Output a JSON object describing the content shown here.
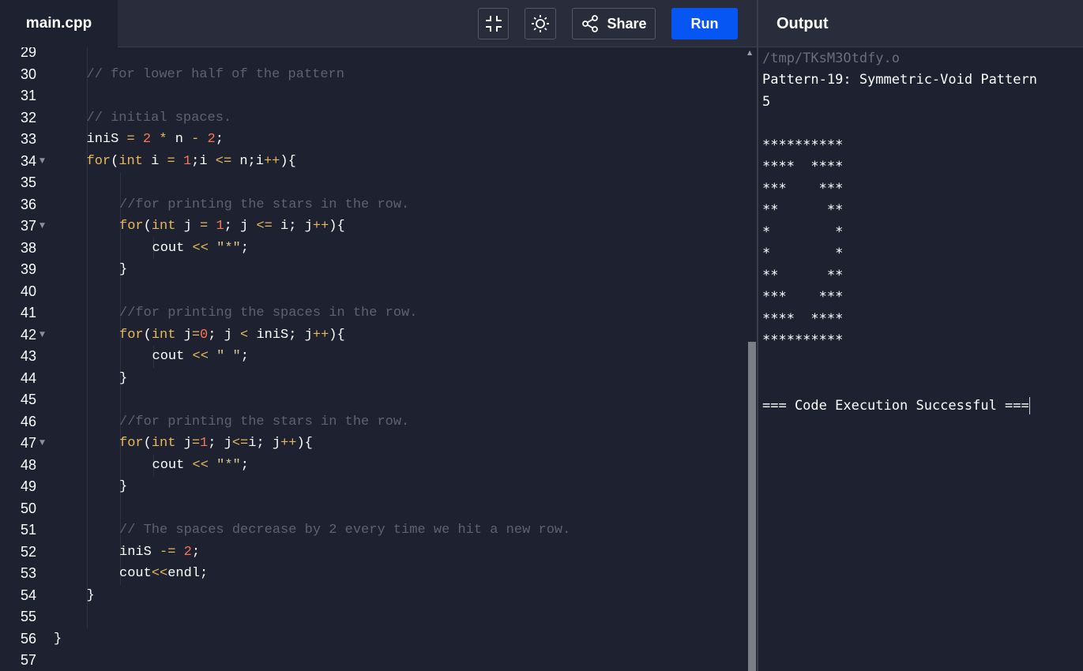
{
  "file_tab": {
    "label": "main.cpp"
  },
  "toolbar": {
    "collapse_icon": "collapse-icon",
    "theme_icon": "sun-icon",
    "share_icon": "share-icon",
    "share_label": "Share",
    "run_label": "Run"
  },
  "output_panel": {
    "title": "Output",
    "path": "/tmp/TKsM3Otdfy.o",
    "lines": [
      "Pattern-19: Symmetric-Void Pattern",
      "5",
      "",
      "**********",
      "****  ****",
      "***    ***",
      "**      **",
      "*        *",
      "*        *",
      "**      **",
      "***    ***",
      "****  ****",
      "**********",
      "",
      "",
      "=== Code Execution Successful ==="
    ]
  },
  "colors": {
    "background": "#1d2130",
    "topbar": "#292d3b",
    "run_button": "#0556f3",
    "comment": "#5c6370",
    "keyword": "#e8b85c",
    "number": "#f7765a",
    "string": "#d8c891"
  },
  "editor": {
    "lines": [
      {
        "n": "29",
        "fold": false,
        "indent": 1,
        "tokens": []
      },
      {
        "n": "30",
        "fold": false,
        "indent": 1,
        "tokens": [
          {
            "t": "// for lower half of the pattern",
            "c": "cm"
          }
        ]
      },
      {
        "n": "31",
        "fold": false,
        "indent": 1,
        "tokens": []
      },
      {
        "n": "32",
        "fold": false,
        "indent": 1,
        "tokens": [
          {
            "t": "// initial spaces.",
            "c": "cm"
          }
        ]
      },
      {
        "n": "33",
        "fold": false,
        "indent": 1,
        "tokens": [
          {
            "t": "iniS ",
            "c": ""
          },
          {
            "t": "=",
            "c": "op"
          },
          {
            "t": " ",
            "c": ""
          },
          {
            "t": "2",
            "c": "num"
          },
          {
            "t": " ",
            "c": ""
          },
          {
            "t": "*",
            "c": "op"
          },
          {
            "t": " n ",
            "c": ""
          },
          {
            "t": "-",
            "c": "op"
          },
          {
            "t": " ",
            "c": ""
          },
          {
            "t": "2",
            "c": "num"
          },
          {
            "t": ";",
            "c": ""
          }
        ]
      },
      {
        "n": "34",
        "fold": true,
        "indent": 1,
        "tokens": [
          {
            "t": "for",
            "c": "kw"
          },
          {
            "t": "(",
            "c": ""
          },
          {
            "t": "int",
            "c": "kw"
          },
          {
            "t": " i ",
            "c": ""
          },
          {
            "t": "=",
            "c": "op"
          },
          {
            "t": " ",
            "c": ""
          },
          {
            "t": "1",
            "c": "num"
          },
          {
            "t": ";i ",
            "c": ""
          },
          {
            "t": "<=",
            "c": "op"
          },
          {
            "t": " n;i",
            "c": ""
          },
          {
            "t": "++",
            "c": "op"
          },
          {
            "t": "){",
            "c": ""
          }
        ]
      },
      {
        "n": "35",
        "fold": false,
        "indent": 2,
        "tokens": []
      },
      {
        "n": "36",
        "fold": false,
        "indent": 2,
        "tokens": [
          {
            "t": "//for printing the stars in the row.",
            "c": "cm"
          }
        ]
      },
      {
        "n": "37",
        "fold": true,
        "indent": 2,
        "tokens": [
          {
            "t": "for",
            "c": "kw"
          },
          {
            "t": "(",
            "c": ""
          },
          {
            "t": "int",
            "c": "kw"
          },
          {
            "t": " j ",
            "c": ""
          },
          {
            "t": "=",
            "c": "op"
          },
          {
            "t": " ",
            "c": ""
          },
          {
            "t": "1",
            "c": "num"
          },
          {
            "t": "; j ",
            "c": ""
          },
          {
            "t": "<=",
            "c": "op"
          },
          {
            "t": " i; j",
            "c": ""
          },
          {
            "t": "++",
            "c": "op"
          },
          {
            "t": "){",
            "c": ""
          }
        ]
      },
      {
        "n": "38",
        "fold": false,
        "indent": 3,
        "tokens": [
          {
            "t": "cout ",
            "c": ""
          },
          {
            "t": "<<",
            "c": "op"
          },
          {
            "t": " ",
            "c": ""
          },
          {
            "t": "\"*\"",
            "c": "str"
          },
          {
            "t": ";",
            "c": ""
          }
        ]
      },
      {
        "n": "39",
        "fold": false,
        "indent": 2,
        "tokens": [
          {
            "t": "}",
            "c": ""
          }
        ]
      },
      {
        "n": "40",
        "fold": false,
        "indent": 2,
        "tokens": []
      },
      {
        "n": "41",
        "fold": false,
        "indent": 2,
        "tokens": [
          {
            "t": "//for printing the spaces in the row.",
            "c": "cm"
          }
        ]
      },
      {
        "n": "42",
        "fold": true,
        "indent": 2,
        "tokens": [
          {
            "t": "for",
            "c": "kw"
          },
          {
            "t": "(",
            "c": ""
          },
          {
            "t": "int",
            "c": "kw"
          },
          {
            "t": " j",
            "c": ""
          },
          {
            "t": "=",
            "c": "op"
          },
          {
            "t": "0",
            "c": "num"
          },
          {
            "t": "; j ",
            "c": ""
          },
          {
            "t": "<",
            "c": "op"
          },
          {
            "t": " iniS; j",
            "c": ""
          },
          {
            "t": "++",
            "c": "op"
          },
          {
            "t": "){",
            "c": ""
          }
        ]
      },
      {
        "n": "43",
        "fold": false,
        "indent": 3,
        "tokens": [
          {
            "t": "cout ",
            "c": ""
          },
          {
            "t": "<<",
            "c": "op"
          },
          {
            "t": " ",
            "c": ""
          },
          {
            "t": "\" \"",
            "c": "str"
          },
          {
            "t": ";",
            "c": ""
          }
        ]
      },
      {
        "n": "44",
        "fold": false,
        "indent": 2,
        "tokens": [
          {
            "t": "}",
            "c": ""
          }
        ]
      },
      {
        "n": "45",
        "fold": false,
        "indent": 2,
        "tokens": []
      },
      {
        "n": "46",
        "fold": false,
        "indent": 2,
        "tokens": [
          {
            "t": "//for printing the stars in the row.",
            "c": "cm"
          }
        ]
      },
      {
        "n": "47",
        "fold": true,
        "indent": 2,
        "tokens": [
          {
            "t": "for",
            "c": "kw"
          },
          {
            "t": "(",
            "c": ""
          },
          {
            "t": "int",
            "c": "kw"
          },
          {
            "t": " j",
            "c": ""
          },
          {
            "t": "=",
            "c": "op"
          },
          {
            "t": "1",
            "c": "num"
          },
          {
            "t": "; j",
            "c": ""
          },
          {
            "t": "<=",
            "c": "op"
          },
          {
            "t": "i; j",
            "c": ""
          },
          {
            "t": "++",
            "c": "op"
          },
          {
            "t": "){",
            "c": ""
          }
        ]
      },
      {
        "n": "48",
        "fold": false,
        "indent": 3,
        "tokens": [
          {
            "t": "cout ",
            "c": ""
          },
          {
            "t": "<<",
            "c": "op"
          },
          {
            "t": " ",
            "c": ""
          },
          {
            "t": "\"*\"",
            "c": "str"
          },
          {
            "t": ";",
            "c": ""
          }
        ]
      },
      {
        "n": "49",
        "fold": false,
        "indent": 2,
        "tokens": [
          {
            "t": "}",
            "c": ""
          }
        ]
      },
      {
        "n": "50",
        "fold": false,
        "indent": 2,
        "tokens": []
      },
      {
        "n": "51",
        "fold": false,
        "indent": 2,
        "tokens": [
          {
            "t": "// The spaces decrease by 2 every time we hit a new row.",
            "c": "cm"
          }
        ]
      },
      {
        "n": "52",
        "fold": false,
        "indent": 2,
        "tokens": [
          {
            "t": "iniS ",
            "c": ""
          },
          {
            "t": "-=",
            "c": "op"
          },
          {
            "t": " ",
            "c": ""
          },
          {
            "t": "2",
            "c": "num"
          },
          {
            "t": ";",
            "c": ""
          }
        ]
      },
      {
        "n": "53",
        "fold": false,
        "indent": 2,
        "tokens": [
          {
            "t": "cout",
            "c": ""
          },
          {
            "t": "<<",
            "c": "op"
          },
          {
            "t": "endl;",
            "c": ""
          }
        ]
      },
      {
        "n": "54",
        "fold": false,
        "indent": 1,
        "tokens": [
          {
            "t": "}",
            "c": ""
          }
        ]
      },
      {
        "n": "55",
        "fold": false,
        "indent": 1,
        "tokens": []
      },
      {
        "n": "56",
        "fold": false,
        "indent": 0,
        "tokens": [
          {
            "t": "}",
            "c": ""
          }
        ]
      },
      {
        "n": "57",
        "fold": false,
        "indent": 0,
        "tokens": []
      }
    ]
  }
}
